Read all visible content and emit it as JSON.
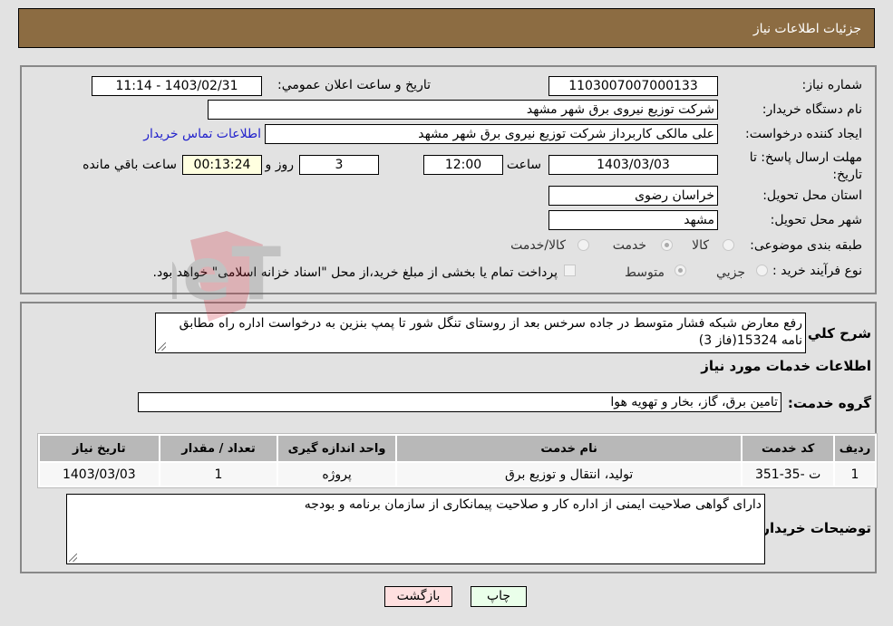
{
  "header": {
    "title": "جزئیات اطلاعات نیاز"
  },
  "form": {
    "need_number": {
      "label": "شماره نیاز:",
      "value": "1103007007000133"
    },
    "announce_datetime": {
      "label": "تاریخ و ساعت اعلان عمومي:",
      "value": "1403/02/31 - 11:14"
    },
    "buyer_org": {
      "label": "نام دستگاه خریدار:",
      "value": "شرکت توزیع نیروی برق شهر مشهد"
    },
    "requester": {
      "label": "ایجاد کننده درخواست:",
      "value": "علی مالکی کاربرداز شرکت توزیع نیروی برق شهر مشهد"
    },
    "buyer_contact_link": "اطلاعات تماس خریدار",
    "deadline": {
      "label": "مهلت ارسال پاسخ: تا تاریخ:",
      "date": "1403/03/03",
      "time_label": "ساعت",
      "time": "12:00",
      "days": "3",
      "days_label": "روز و",
      "remaining": "00:13:24",
      "remaining_label": "ساعت باقي مانده"
    },
    "province": {
      "label": "استان محل تحویل:",
      "value": "خراسان رضوی"
    },
    "city": {
      "label": "شهر محل تحویل:",
      "value": "مشهد"
    },
    "category": {
      "label": "طبقه بندی موضوعی:",
      "options": [
        "کالا",
        "خدمت",
        "کالا/خدمت"
      ],
      "selected": "خدمت"
    },
    "purchase_type": {
      "label": "نوع فرآیند خرید :",
      "options": [
        "جزیي",
        "متوسط"
      ],
      "selected": "متوسط",
      "treasury_note": "پرداخت تمام یا بخشی از مبلغ خرید،از محل \"اسناد خزانه اسلامی\" خواهد بود."
    }
  },
  "details": {
    "description_label": "شرح کلي نیاز:",
    "description": "رفع معارض شبکه فشار متوسط در جاده سرخس بعد از روستای تنگل شور تا پمپ بنزین به درخواست اداره راه مطابق نامه 15324(فاز 3)",
    "services_title": "اطلاعات خدمات مورد نیاز",
    "service_group_label": "گروه خدمت:",
    "service_group": "تامین برق، گاز، بخار و تهویه هوا",
    "table": {
      "headers": [
        "ردیف",
        "کد خدمت",
        "نام خدمت",
        "واحد اندازه گیری",
        "تعداد / مقدار",
        "تاریخ نیاز"
      ],
      "rows": [
        [
          "1",
          "ت -35-351",
          "تولید، انتقال و توزیع برق",
          "پروژه",
          "1",
          "1403/03/03"
        ]
      ]
    },
    "buyer_notes_label": "توضیحات خریدار:",
    "buyer_notes": "دارای گواهی صلاحیت ایمنی از اداره کار و صلاحیت پیمانکاری از سازمان برنامه و بودجه"
  },
  "buttons": {
    "print": "چاپ",
    "back": "بازگشت"
  },
  "watermark": "AriaTender.neT"
}
